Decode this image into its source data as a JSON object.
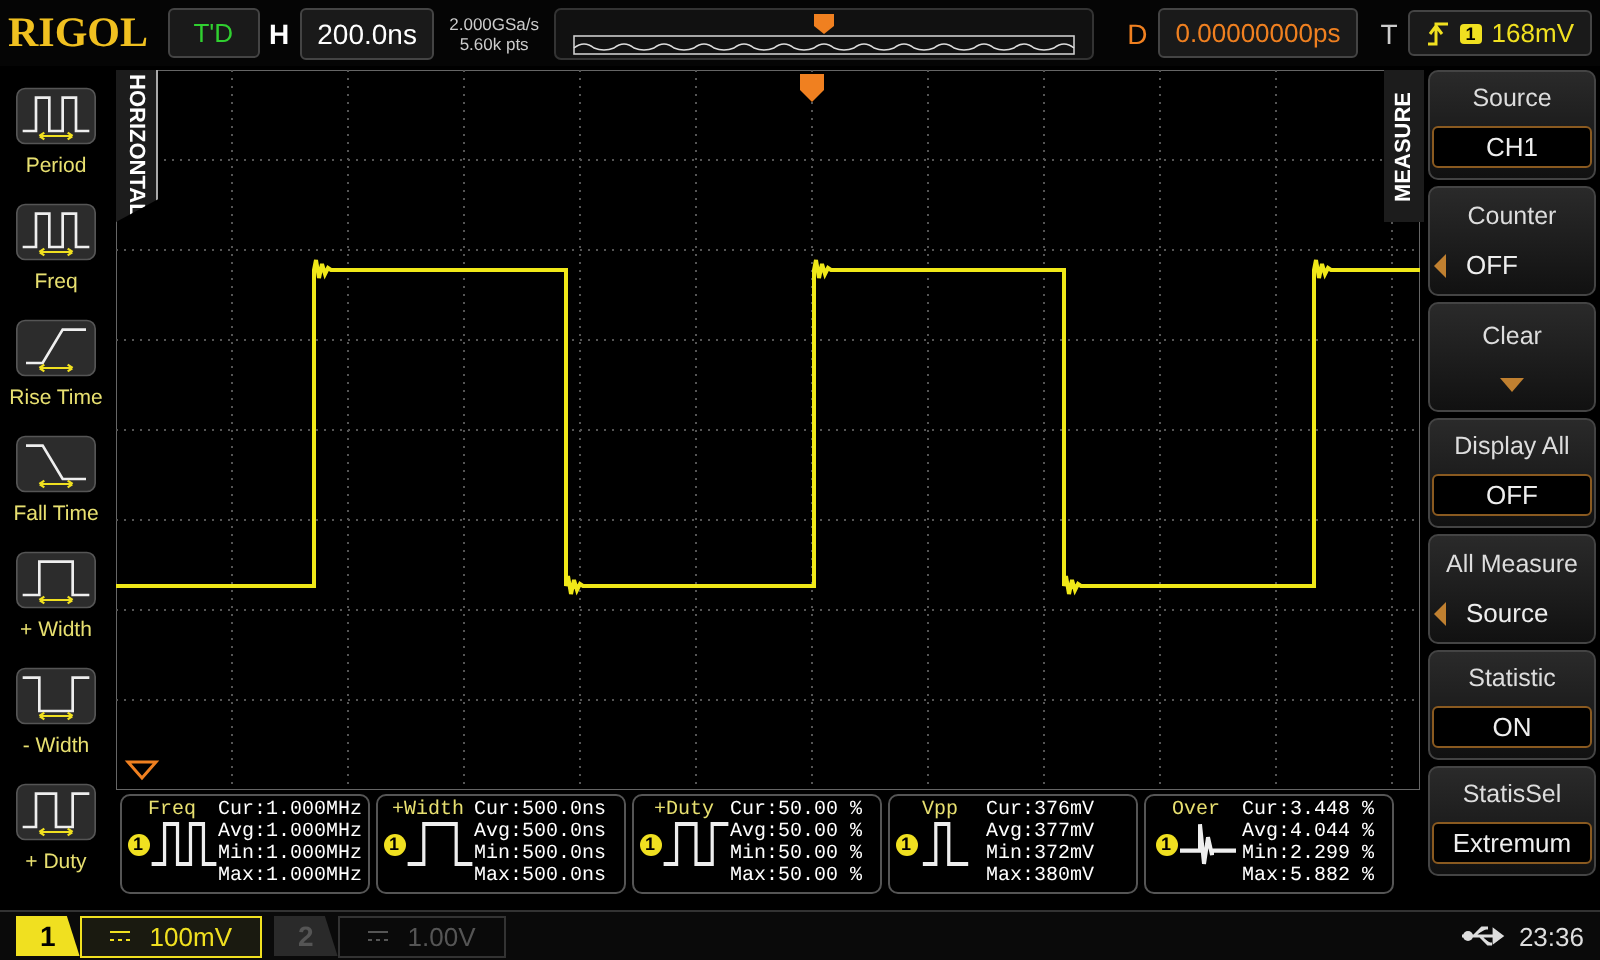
{
  "top_bar": {
    "logo": "RIGOL",
    "run_state": "T'D",
    "timebase_label": "H",
    "timebase": "200.0ns",
    "sample_rate": "2.000GSa/s",
    "memory_depth": "5.60k pts",
    "delay_label": "D",
    "delay": "0.00000000ps",
    "trigger_label": "T",
    "trigger_channel": "1",
    "trigger_level": "168mV"
  },
  "horizontal_tab": "HORIZONTAL",
  "measure_buttons": [
    {
      "label": "Period",
      "kind": "period"
    },
    {
      "label": "Freq",
      "kind": "freq"
    },
    {
      "label": "Rise Time",
      "kind": "rise"
    },
    {
      "label": "Fall Time",
      "kind": "fall"
    },
    {
      "label": "+ Width",
      "kind": "pwidth"
    },
    {
      "label": "- Width",
      "kind": "nwidth"
    },
    {
      "label": "+ Duty",
      "kind": "duty"
    }
  ],
  "measure_tab": "MEASURE",
  "menu": [
    {
      "title": "Source",
      "value": "CH1",
      "kind": "value"
    },
    {
      "title": "Counter",
      "value": "OFF",
      "kind": "arrow"
    },
    {
      "title": "Clear",
      "kind": "dropdown"
    },
    {
      "title": "Display All",
      "value": "OFF",
      "kind": "value"
    },
    {
      "title": "All Measure",
      "value": "Source",
      "kind": "arrow"
    },
    {
      "title": "Statistic",
      "value": "ON",
      "kind": "value"
    },
    {
      "title": "StatisSel",
      "value": "Extremum",
      "kind": "value"
    }
  ],
  "measurements": [
    {
      "name": "Freq",
      "channel": "1",
      "kind": "freq",
      "lines": [
        "Cur:1.000MHz",
        "Avg:1.000MHz",
        "Min:1.000MHz",
        "Max:1.000MHz"
      ]
    },
    {
      "name": "+Width",
      "channel": "1",
      "kind": "pwidth",
      "lines": [
        "Cur:500.0ns",
        "Avg:500.0ns",
        "Min:500.0ns",
        "Max:500.0ns"
      ]
    },
    {
      "name": "+Duty",
      "channel": "1",
      "kind": "duty",
      "lines": [
        "Cur:50.00 %",
        "Avg:50.00 %",
        "Min:50.00 %",
        "Max:50.00 %"
      ]
    },
    {
      "name": "Vpp",
      "channel": "1",
      "kind": "vpp",
      "lines": [
        "Cur:376mV",
        "Avg:377mV",
        "Min:372mV",
        "Max:380mV"
      ]
    },
    {
      "name": "Over",
      "channel": "1",
      "kind": "over",
      "lines": [
        "Cur:3.448 %",
        "Avg:4.044 %",
        "Min:2.299 %",
        "Max:5.882 %"
      ]
    }
  ],
  "channels": [
    {
      "number": "1",
      "scale": "100mV",
      "enabled": true
    },
    {
      "number": "2",
      "scale": "1.00V",
      "enabled": false
    }
  ],
  "status": {
    "time": "23:36"
  }
}
